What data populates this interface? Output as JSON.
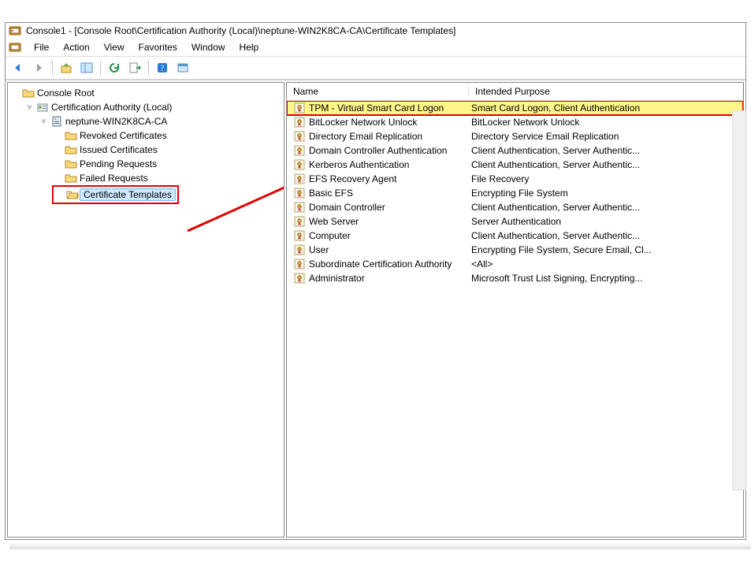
{
  "title": "Console1 - [Console Root\\Certification Authority (Local)\\neptune-WIN2K8CA-CA\\Certificate Templates]",
  "menu": {
    "file": "File",
    "action": "Action",
    "view": "View",
    "favorites": "Favorites",
    "window": "Window",
    "help": "Help"
  },
  "tree": {
    "root": "Console Root",
    "ca": "Certification Authority (Local)",
    "server": "neptune-WIN2K8CA-CA",
    "items": {
      "revoked": "Revoked Certificates",
      "issued": "Issued Certificates",
      "pending": "Pending Requests",
      "failed": "Failed Requests",
      "templates": "Certificate Templates"
    }
  },
  "columns": {
    "name": "Name",
    "purpose": "Intended Purpose"
  },
  "rows": [
    {
      "name": "TPM - Virtual Smart Card Logon",
      "purpose": "Smart Card Logon, Client Authentication",
      "hi": true
    },
    {
      "name": "BitLocker Network Unlock",
      "purpose": "BitLocker Network Unlock"
    },
    {
      "name": "Directory Email Replication",
      "purpose": "Directory Service Email Replication"
    },
    {
      "name": "Domain Controller Authentication",
      "purpose": "Client Authentication, Server Authentic..."
    },
    {
      "name": "Kerberos Authentication",
      "purpose": "Client Authentication, Server Authentic..."
    },
    {
      "name": "EFS Recovery Agent",
      "purpose": "File Recovery"
    },
    {
      "name": "Basic EFS",
      "purpose": "Encrypting File System"
    },
    {
      "name": "Domain Controller",
      "purpose": "Client Authentication, Server Authentic..."
    },
    {
      "name": "Web Server",
      "purpose": "Server Authentication"
    },
    {
      "name": "Computer",
      "purpose": "Client Authentication, Server Authentic..."
    },
    {
      "name": "User",
      "purpose": "Encrypting File System, Secure Email, Cl..."
    },
    {
      "name": "Subordinate Certification Authority",
      "purpose": "<All>"
    },
    {
      "name": "Administrator",
      "purpose": "Microsoft Trust List Signing, Encrypting..."
    }
  ],
  "annotations": {
    "highlight_row_index": 0,
    "arrow_from": "tree.certificate_templates",
    "arrow_to": "list.row0"
  }
}
